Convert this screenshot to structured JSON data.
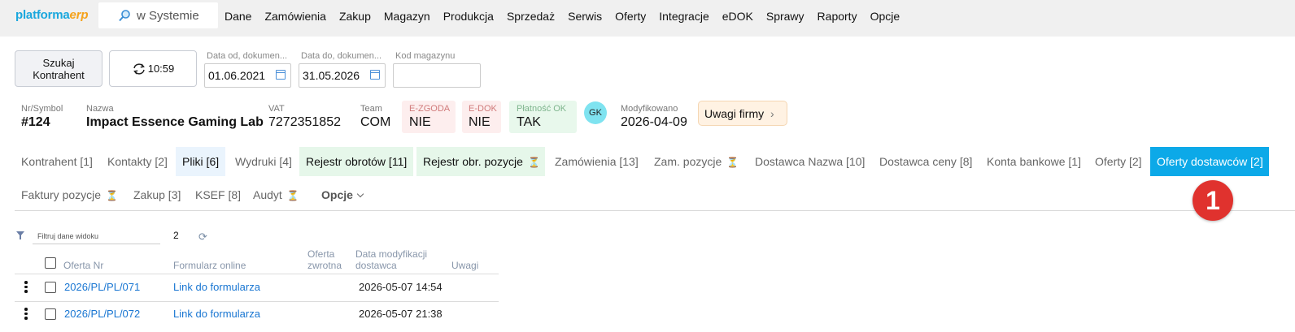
{
  "app": {
    "logo_part1": "platforma",
    "logo_part2": "erp"
  },
  "search": {
    "label": "w Systemie"
  },
  "menu": [
    "Dane",
    "Zamówienia",
    "Zakup",
    "Magazyn",
    "Produkcja",
    "Sprzedaż",
    "Serwis",
    "Oferty",
    "Integracje",
    "eDOK",
    "Sprawy",
    "Raporty",
    "Opcje"
  ],
  "toolbar": {
    "search_line1": "Szukaj",
    "search_line2": "Kontrahent",
    "refresh_time": "10:59",
    "date_from_label": "Data od, dokumen...",
    "date_from_value": "01.06.2021",
    "date_to_label": "Data do, dokumen...",
    "date_to_value": "31.05.2026",
    "warehouse_label": "Kod magazynu",
    "warehouse_value": ""
  },
  "contractor": {
    "symbol_label": "Nr/Symbol",
    "symbol_value": "#124",
    "name_label": "Nazwa",
    "name_value": "Impact Essence Gaming Lab",
    "vat_label": "VAT",
    "vat_value": "7272351852",
    "team_label": "Team",
    "team_value": "COM",
    "ezgoda_label": "E-ZGODA",
    "ezgoda_value": "NIE",
    "edok_label": "E-DOK",
    "edok_value": "NIE",
    "platnosc_label": "Płatność OK",
    "platnosc_value": "TAK",
    "avatar": "GK",
    "modified_label": "Modyfikowano",
    "modified_value": "2026-04-09",
    "notes_button": "Uwagi firmy"
  },
  "tabs_row1": [
    {
      "label": "Kontrahent [1]"
    },
    {
      "label": "Kontakty [2]"
    },
    {
      "label": "Pliki [6]"
    },
    {
      "label": "Wydruki [4]"
    },
    {
      "label": "Rejestr obrotów [11]"
    },
    {
      "label": "Rejestr obr. pozycje"
    },
    {
      "label": "Zamówienia [13]"
    },
    {
      "label": "Zam. pozycje"
    },
    {
      "label": "Dostawca Nazwa [10]"
    },
    {
      "label": "Dostawca ceny [8]"
    },
    {
      "label": "Konta bankowe [1]"
    },
    {
      "label": "Oferty [2]"
    },
    {
      "label": "Oferty dostawców [2]"
    }
  ],
  "tabs_row2": [
    {
      "label": "Faktury pozycje"
    },
    {
      "label": "Zakup [3]"
    },
    {
      "label": "KSEF [8]"
    },
    {
      "label": "Audyt"
    },
    {
      "label": "Opcje"
    }
  ],
  "annotation_badge": "1",
  "grid": {
    "filter_placeholder": "Filtruj dane widoku",
    "count": "2",
    "columns": {
      "offer_nr": "Oferta Nr",
      "form": "Formularz online",
      "return_line1": "Oferta",
      "return_line2": "zwrotna",
      "date_line1": "Data modyfikacji",
      "date_line2": "dostawca",
      "notes": "Uwagi"
    },
    "rows": [
      {
        "offer_nr": "2026/PL/PL/071",
        "form": "Link do formularza",
        "date": "2026-05-07 14:54"
      },
      {
        "offer_nr": "2026/PL/PL/072",
        "form": "Link do formularza",
        "date": "2026-05-07 21:38"
      }
    ]
  },
  "colors": {
    "accent": "#0ca9e8",
    "link": "#1976d2",
    "badge": "#e0322e"
  }
}
